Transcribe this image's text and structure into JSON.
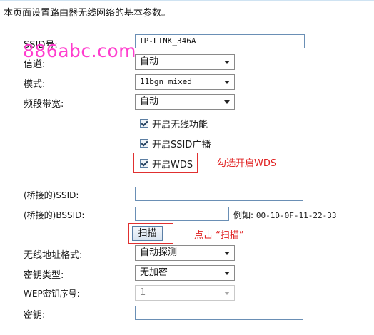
{
  "intro": "本页面设置路由器无线网络的基本参数。",
  "watermark": "886abc.com",
  "form": {
    "ssid_label": "SSID号:",
    "ssid_value": "TP-LINK_346A",
    "channel_label": "信道:",
    "channel_value": "自动",
    "mode_label": "模式:",
    "mode_value": "11bgn mixed",
    "bandwidth_label": "频段带宽:",
    "bandwidth_value": "自动",
    "enable_wireless_label": "开启无线功能",
    "enable_ssid_broadcast_label": "开启SSID广播",
    "enable_wds_label": "开启WDS",
    "bridged_ssid_label": "(桥接的)SSID:",
    "bridged_ssid_value": "",
    "bridged_bssid_label": "(桥接的)BSSID:",
    "bridged_bssid_value": "",
    "bssid_example_prefix": "例如:",
    "bssid_example_value": "00-1D-0F-11-22-33",
    "scan_button": "扫描",
    "addr_format_label": "无线地址格式:",
    "addr_format_value": "自动探测",
    "key_type_label": "密钥类型:",
    "key_type_value": "无加密",
    "wep_index_label": "WEP密钥序号:",
    "wep_index_value": "1",
    "key_label": "密钥:",
    "key_value": ""
  },
  "annotations": {
    "wds_note": "勾选开启WDS",
    "scan_note": "点击 “扫描”",
    "color": "#e02020"
  }
}
